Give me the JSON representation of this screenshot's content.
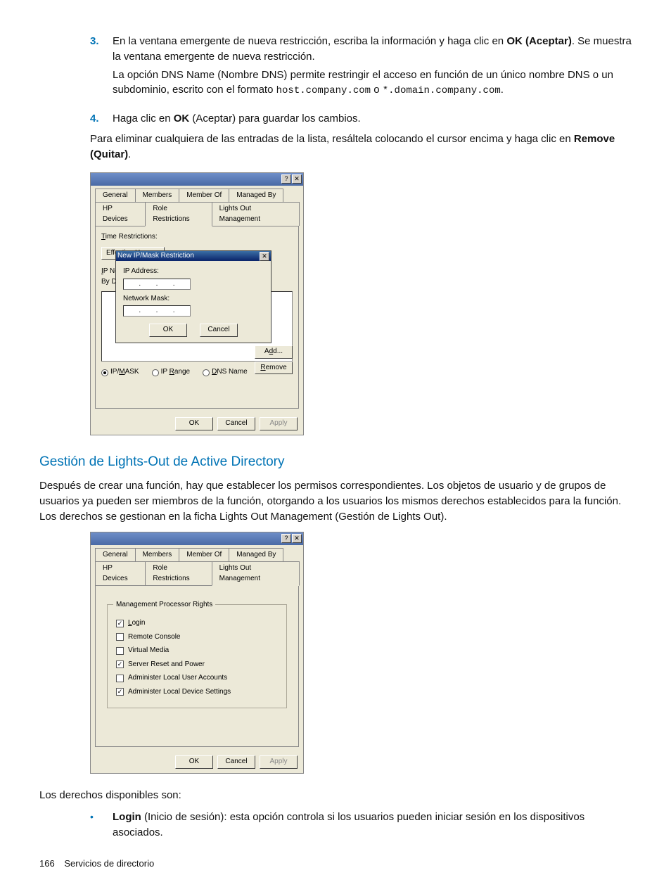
{
  "step3": {
    "num": "3.",
    "line1a": "En la ventana emergente de nueva restricción, escriba la información y haga clic en ",
    "ok_bold": "OK (Aceptar)",
    "line1b": ". Se muestra la ventana emergente de nueva restricción.",
    "line2a": "La opción DNS Name (Nombre DNS) permite restringir el acceso en función de un único nombre DNS o un subdominio, escrito con el formato ",
    "code1": "host.company.com",
    "line2b": " o ",
    "code2": "*.domain.company.com",
    "line2c": "."
  },
  "step4": {
    "num": "4.",
    "text_a": "Haga clic en ",
    "ok_bold": "OK",
    "text_b": " (Aceptar) para guardar los cambios."
  },
  "after_steps": {
    "a": "Para eliminar cualquiera de las entradas de la lista, resáltela colocando el cursor encima y haga clic en ",
    "bold": "Remove (Quitar)",
    "b": "."
  },
  "shot1": {
    "help": "?",
    "close": "✕",
    "tabs": {
      "general": "General",
      "members": "Members",
      "member_of": "Member Of",
      "managed_by": "Managed By",
      "hp_devices": "HP Devices",
      "role_restrictions": "Role Restrictions",
      "lights_out": "Lights Out Management"
    },
    "time_restrictions": "Time Restrictions:",
    "effective_hours": "Effective Hours...",
    "ipnet_prefix": "IP Net",
    "by_def": "By Def",
    "radios": {
      "ipmask": "IP/MASK",
      "iprange": "IP Range",
      "dnsname": "DNS Name"
    },
    "add": "Add...",
    "remove": "Remove",
    "ok": "OK",
    "cancel": "Cancel",
    "apply": "Apply",
    "popup": {
      "title": "New IP/Mask Restriction",
      "close": "✕",
      "ip_label": "IP Address:",
      "mask_label": "Network Mask:",
      "dot": ".",
      "ok": "OK",
      "cancel": "Cancel"
    }
  },
  "section_heading": "Gestión de Lights-Out de Active Directory",
  "section_para": "Después de crear una función, hay que establecer los permisos correspondientes. Los objetos de usuario y de grupos de usuarios ya pueden ser miembros de la función, otorgando a los usuarios los mismos derechos establecidos para la función. Los derechos se gestionan en la ficha Lights Out Management (Gestión de Lights Out).",
  "shot2": {
    "group_title": "Management Processor Rights",
    "rights": {
      "login": "Login",
      "remote_console": "Remote Console",
      "virtual_media": "Virtual Media",
      "server_reset": "Server Reset and Power",
      "admin_users": "Administer Local User Accounts",
      "admin_device": "Administer Local Device Settings"
    }
  },
  "rights_intro": "Los derechos disponibles son:",
  "bullet1": {
    "bold": "Login",
    "rest": " (Inicio de sesión): esta opción controla si los usuarios pueden iniciar sesión en los dispositivos asociados."
  },
  "footer": {
    "page": "166",
    "chapter": "Servicios de directorio"
  }
}
